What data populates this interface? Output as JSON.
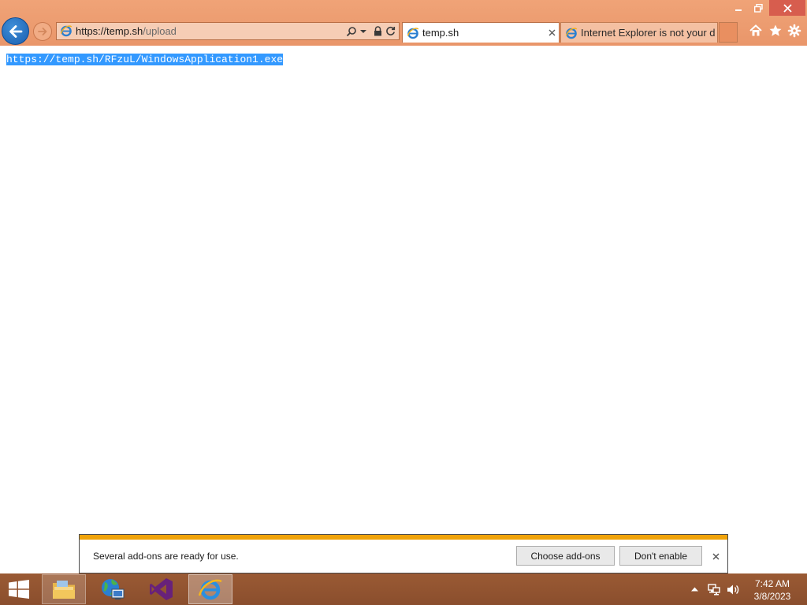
{
  "window": {
    "controls": {
      "minimize": "minimize",
      "restore": "restore",
      "close": "close"
    }
  },
  "browser": {
    "address": {
      "host": "https://temp.sh",
      "path": "/upload"
    },
    "tabs": [
      {
        "title": "temp.sh",
        "active": true
      },
      {
        "title": "Internet Explorer is not your de...",
        "active": false
      }
    ],
    "toolbar_icons": [
      "home-icon",
      "favorites-star-icon",
      "tools-gear-icon"
    ]
  },
  "page": {
    "selected_text": "https://temp.sh/RFzuL/WindowsApplication1.exe"
  },
  "notification": {
    "message": "Several add-ons are ready for use.",
    "choose_label": "Choose add-ons",
    "dont_enable_label": "Don't enable",
    "accent_color": "#f0a30a"
  },
  "taskbar": {
    "apps": [
      "file-explorer-icon",
      "network-globe-icon",
      "visual-studio-icon",
      "internet-explorer-icon"
    ],
    "clock": {
      "time": "7:42 AM",
      "date": "3/8/2023"
    }
  },
  "colors": {
    "chrome": "#e9966a",
    "selection": "#3399ff",
    "taskbar": "#8a4e2d",
    "close_button": "#d75d4e"
  }
}
